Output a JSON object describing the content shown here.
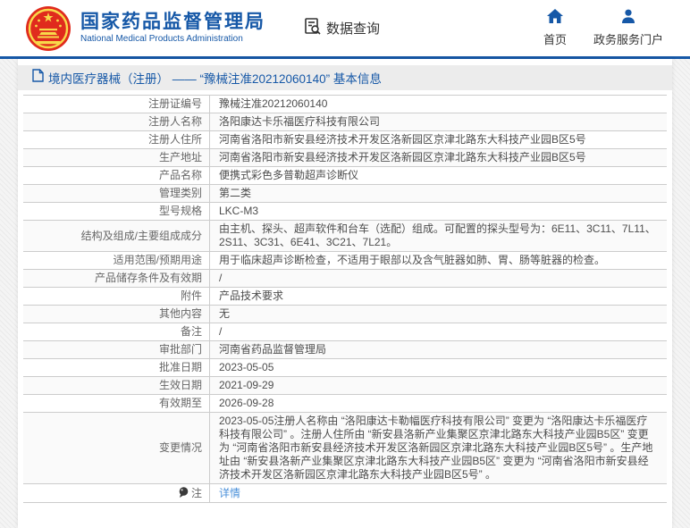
{
  "header": {
    "agency_name_cn": "国家药品监督管理局",
    "agency_name_en": "National Medical Products Administration",
    "nav_query": "数据查询",
    "nav_home": "首页",
    "nav_portal": "政务服务门户",
    "brand_blue": "#1658a7",
    "emblem_red": "#e02b1d",
    "emblem_gold": "#f8d94a"
  },
  "page": {
    "title": "境内医疗器械（注册） —— “豫械注准20212060140” 基本信息"
  },
  "table": {
    "rows": [
      {
        "label": "注册证编号",
        "value": "豫械注准20212060140"
      },
      {
        "label": "注册人名称",
        "value": "洛阳康达卡乐福医疗科技有限公司"
      },
      {
        "label": "注册人住所",
        "value": "河南省洛阳市新安县经济技术开发区洛新园区京津北路东大科技产业园B区5号"
      },
      {
        "label": "生产地址",
        "value": "河南省洛阳市新安县经济技术开发区洛新园区京津北路东大科技产业园B区5号"
      },
      {
        "label": "产品名称",
        "value": "便携式彩色多普勒超声诊断仪"
      },
      {
        "label": "管理类别",
        "value": "第二类"
      },
      {
        "label": "型号规格",
        "value": "LKC-M3"
      },
      {
        "label": "结构及组成/主要组成成分",
        "value": "由主机、探头、超声软件和台车（选配）组成。可配置的探头型号为：6E11、3C11、7L11、2S11、3C31、6E41、3C21、7L21。"
      },
      {
        "label": "适用范围/预期用途",
        "value": "用于临床超声诊断检查，不适用于眼部以及含气脏器如肺、胃、肠等脏器的检查。"
      },
      {
        "label": "产品储存条件及有效期",
        "value": "/"
      },
      {
        "label": "附件",
        "value": "产品技术要求"
      },
      {
        "label": "其他内容",
        "value": "无"
      },
      {
        "label": "备注",
        "value": "/"
      },
      {
        "label": "审批部门",
        "value": "河南省药品监督管理局"
      },
      {
        "label": "批准日期",
        "value": "2023-05-05"
      },
      {
        "label": "生效日期",
        "value": "2021-09-29"
      },
      {
        "label": "有效期至",
        "value": "2026-09-28"
      },
      {
        "label": "变更情况",
        "value": "2023-05-05注册人名称由 “洛阳康达卡勒幅医疗科技有限公司” 变更为 “洛阳康达卡乐福医疗科技有限公司” 。注册人住所由 “新安县洛新产业集聚区京津北路东大科技产业园B5区” 变更为 “河南省洛阳市新安县经济技术开发区洛新园区京津北路东大科技产业园B区5号” 。生产地址由 “新安县洛新产业集聚区京津北路东大科技产业园B5区” 变更为 “河南省洛阳市新安县经济技术开发区洛新园区京津北路东大科技产业园B区5号” 。"
      },
      {
        "label": "注",
        "value": "详情",
        "link": true,
        "icon": "note-balloon-icon"
      }
    ]
  }
}
